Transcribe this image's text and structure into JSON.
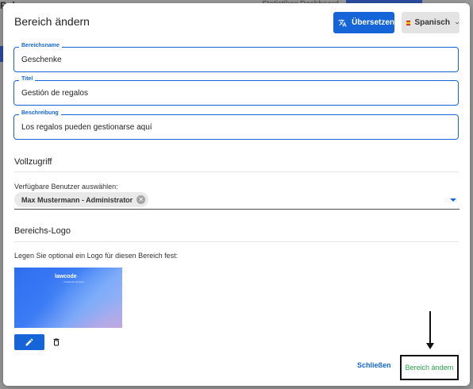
{
  "background": {
    "brand": "Pulse",
    "tabs": [
      "Statistiken",
      "Dashboard"
    ]
  },
  "dialog": {
    "title": "Bereich ändern",
    "translate_button": "Übersetzen",
    "language": "Spanisch",
    "fields": {
      "name": {
        "label": "Bereichsname",
        "value": "Geschenke"
      },
      "title": {
        "label": "Titel",
        "value": "Gestión de regalos"
      },
      "description": {
        "label": "Beschreibung",
        "value": "Los regalos pueden gestionarse aquí"
      }
    },
    "full_access": {
      "heading": "Vollzugriff",
      "users_label": "Verfügbare Benutzer auswählen:",
      "selected_user": "Max Mustermann - Administrator"
    },
    "logo": {
      "heading": "Bereichs-Logo",
      "hint": "Legen Sie optional ein Logo für diesen Bereich fest:",
      "brand": "lawcode",
      "brand_sub": "a lawcode company"
    },
    "close_button": "Schließen",
    "submit_button": "Bereich ändern"
  },
  "colors": {
    "primary": "#1565d8",
    "success_text": "#2aa84a",
    "overlay": "#8a8a8a"
  },
  "icons": [
    "translate-icon",
    "chevron-down-icon",
    "close-circle-icon",
    "dropdown-caret-icon",
    "pencil-icon",
    "trash-icon",
    "annotation-arrow"
  ]
}
